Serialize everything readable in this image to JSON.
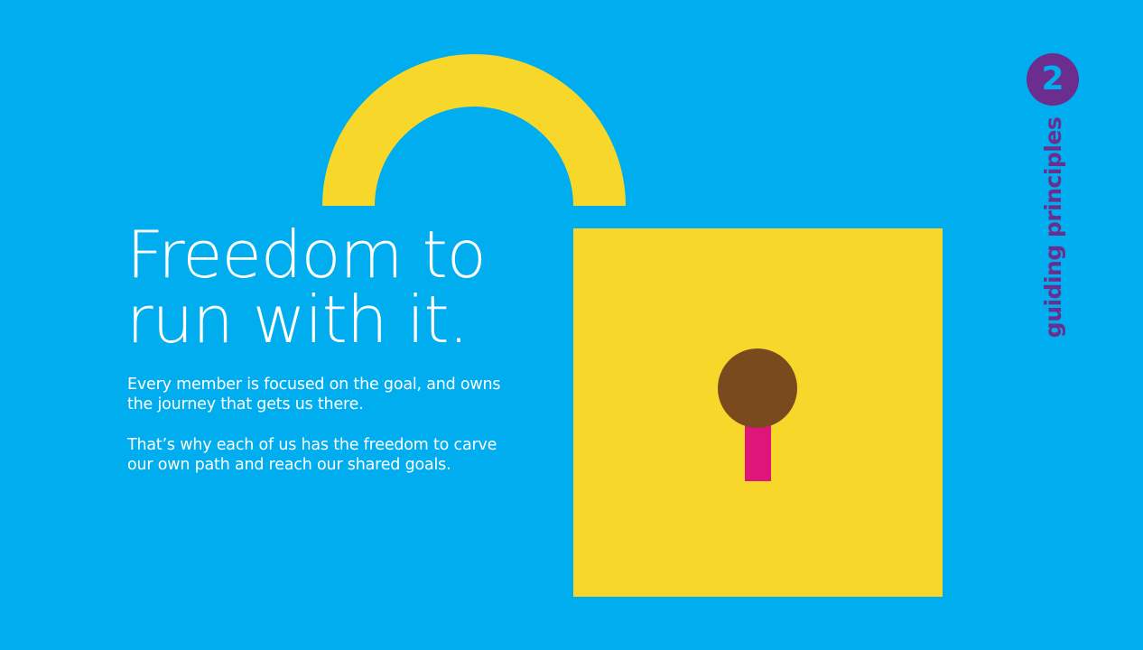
{
  "headline": {
    "line1": "Freedom to",
    "line2": "run with it."
  },
  "body": {
    "paragraph1": "Every member is focused on the goal, and owns the journey that gets us there.",
    "paragraph2": "That’s why each of us has the freedom to carve our own path and reach our shared goals."
  },
  "section": {
    "number": "2",
    "label": "guiding principles"
  },
  "colors": {
    "background": "#00aeef",
    "lock": "#f7d72a",
    "keyhole_circle": "#7a4a1f",
    "keyhole_slot": "#e0157b",
    "accent_purple": "#6b2d8e",
    "text": "#ffffff"
  },
  "icons": {
    "illustration": "open-padlock-icon"
  }
}
